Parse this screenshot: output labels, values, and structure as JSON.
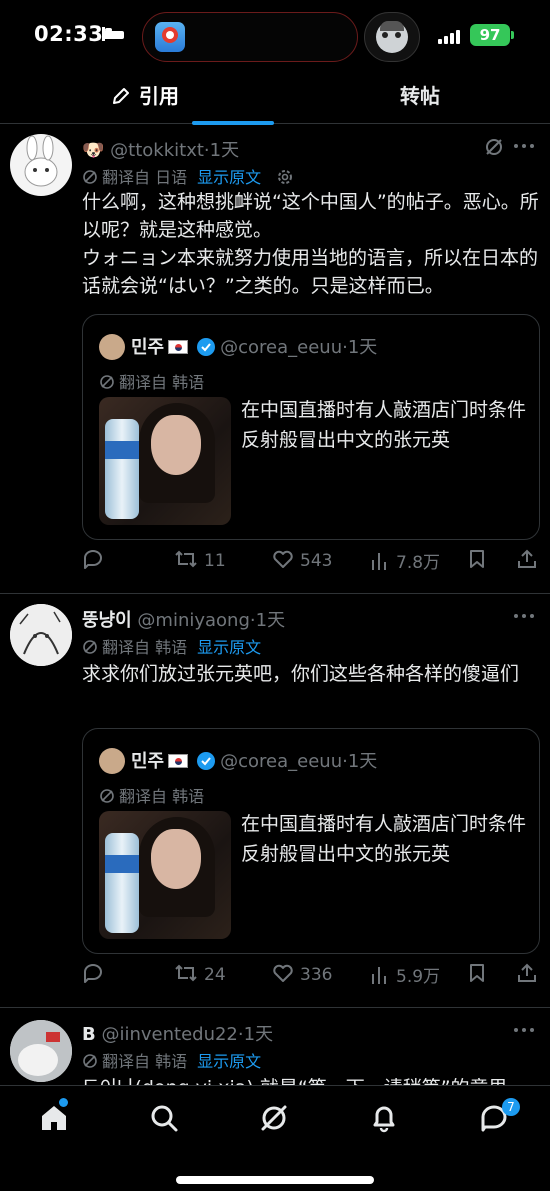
{
  "status_bar": {
    "time": "02:33",
    "battery": "97"
  },
  "tabs": [
    {
      "label": "引用"
    },
    {
      "label": "转帖"
    }
  ],
  "tweets": [
    {
      "name": "🐶",
      "handle": "@ttokkitxt",
      "time": "·1天",
      "translated_from": "翻译自 日语",
      "show_original": "显示原文",
      "paragraphs": [
        "什么啊，这种想挑衅说“这个中国人”的帖子。恶心。所以呢？就是这种感觉。",
        "ウォニョン本来就努力使用当地的语言，所以在日本的话就会说“はい？”之类的。只是这样而已。"
      ],
      "quote": {
        "name": "민주",
        "handle": "@corea_eeuu",
        "time": "·1天",
        "translated_from": "翻译自 韩语",
        "text": "在中国直播时有人敲酒店门时条件反射般冒出中文的张元英"
      },
      "stats": {
        "replies": "",
        "retweets": "11",
        "likes": "543",
        "views": "7.8万"
      }
    },
    {
      "name": "뚱냥이",
      "handle": "@miniyaong",
      "time": "·1天",
      "translated_from": "翻译自 韩语",
      "show_original": "显示原文",
      "paragraphs": [
        "求求你们放过张元英吧，你们这些各种各样的傻逼们"
      ],
      "quote": {
        "name": "민주",
        "handle": "@corea_eeuu",
        "time": "·1天",
        "translated_from": "翻译自 韩语",
        "text": "在中国直播时有人敲酒店门时条件反射般冒出中文的张元英"
      },
      "stats": {
        "replies": "",
        "retweets": "24",
        "likes": "336",
        "views": "5.9万"
      }
    },
    {
      "name": "B",
      "handle": "@iinventedu22",
      "time": "·1天",
      "translated_from": "翻译自 韩语",
      "show_original": "显示原文",
      "paragraphs": [
        "됴이나(dong yi xia) 就是“等一下，请稍等”的意思"
      ]
    }
  ],
  "tab_bar": {
    "messages_badge": "7"
  },
  "colors": {
    "accent": "#1d9bf0",
    "background": "#000000",
    "muted": "#71767b"
  },
  "icons": [
    "pen-icon",
    "grok-icon",
    "translate-icon",
    "reply-icon",
    "retweet-icon",
    "like-icon",
    "views-icon",
    "bookmark-icon",
    "share-icon",
    "home-icon",
    "search-icon",
    "grok-nav-icon",
    "bell-icon",
    "messages-icon"
  ]
}
